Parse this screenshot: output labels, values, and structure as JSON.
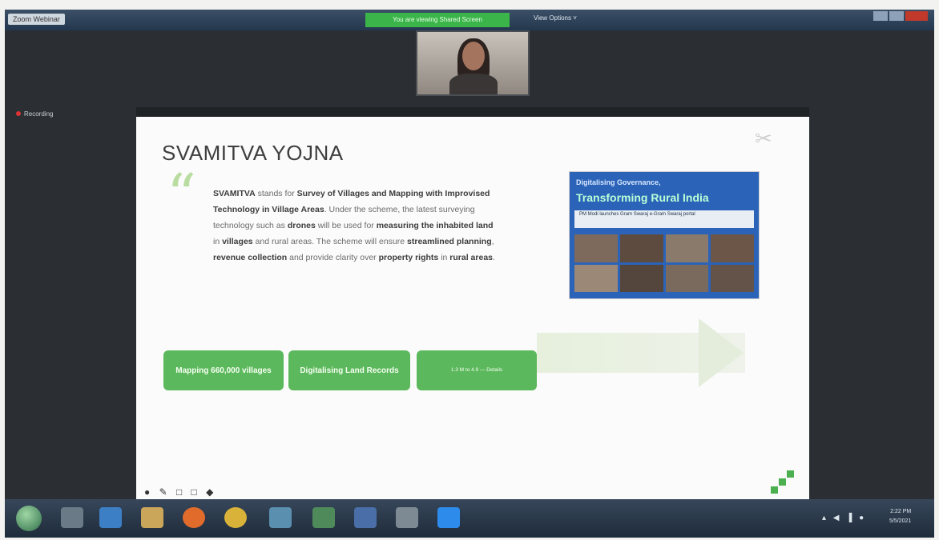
{
  "zoom": {
    "app_title": "Zoom Webinar",
    "share_banner": "You are viewing Shared Screen",
    "view_options": "View Options ˅",
    "recording_label": "Recording"
  },
  "slide": {
    "title": "SVAMITVA YOJNA",
    "quote_icon": "quote-icon",
    "description": {
      "p1_bold": "SVAMITVA",
      "p2": " stands for ",
      "p3_bold": "Survey of Villages and Mapping with Improvised Technology in Village Areas",
      "p4": ". Under the scheme, the latest surveying technology such as ",
      "p5_bold": "drones",
      "p6": " will be used for ",
      "p7_bold": "measuring the inhabited land",
      "p8": " in ",
      "p9_bold": "villages",
      "p10": " and rural areas. The scheme will ensure ",
      "p11_bold": "streamlined planning",
      "p12": ", ",
      "p13_bold": "revenue collection",
      "p14": " and provide clarity over ",
      "p15_bold": "property rights",
      "p16": " in ",
      "p17_bold": "rural areas",
      "p18": "."
    },
    "news": {
      "headline1": "Digitalising Governance,",
      "headline2": "Transforming Rural India",
      "subtext": "PM Modi launches Gram Swaraj e-Gram Swaraj portal"
    },
    "steps": [
      {
        "label": "Mapping 660,000 villages"
      },
      {
        "label": "Digitalising Land Records"
      },
      {
        "label": "1.3 M to 4.9 — Details"
      }
    ],
    "tools": "● ✎ □ □ ◆"
  },
  "taskbar": {
    "tray": "▴ ◀ ▐ ●",
    "time": "2:22 PM",
    "date": "5/5/2021"
  },
  "colors": {
    "accent_green": "#5cb85c",
    "zoom_blue": "#2a63b8",
    "banner_green": "#3bb54a"
  }
}
